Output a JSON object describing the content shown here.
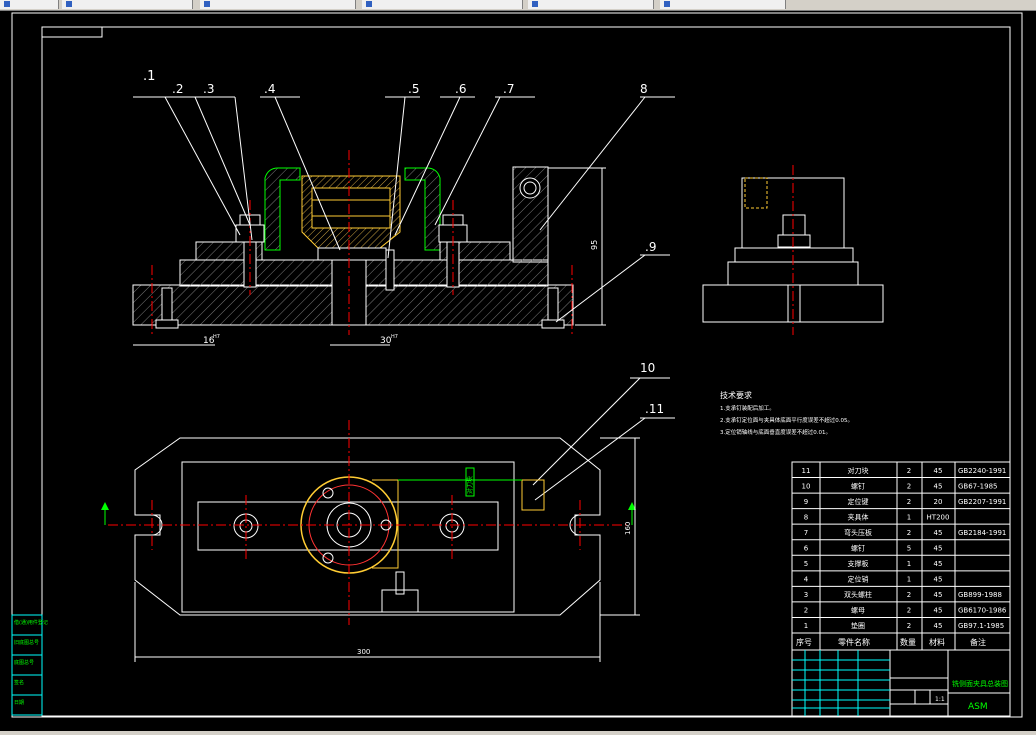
{
  "toolbar": {
    "tabs": [
      {
        "label": ""
      },
      {
        "label": ""
      },
      {
        "label": ""
      },
      {
        "label": ""
      },
      {
        "label": ""
      },
      {
        "label": ""
      }
    ]
  },
  "leader_labels": [
    ".1",
    ".2",
    ".3",
    ".4",
    ".5",
    ".6",
    ".7",
    "8",
    ".9",
    "10",
    ".11"
  ],
  "dims": {
    "d1": "16",
    "d1_tol": "H7",
    "d2": "30",
    "d2_tol": "H7",
    "height": "95",
    "width_plan": "300",
    "depth_plan": "160"
  },
  "tech": {
    "title": "技术要求",
    "items": [
      "1.支承钉装配后加工。",
      "2.支承钉定位面与夹具体底面平行度误差不超过0.05。",
      "3.定位销轴线与底面垂直度误差不超过0.01。"
    ]
  },
  "annotation_green": "对刀块",
  "bom": {
    "headers": {
      "no": "序号",
      "name": "零件名称",
      "qty": "数量",
      "mat": "材料",
      "note": "备注"
    },
    "rows": [
      {
        "no": "11",
        "name": "对刀块",
        "qty": "2",
        "mat": "45",
        "note": "GB2240-1991"
      },
      {
        "no": "10",
        "name": "螺钉",
        "qty": "2",
        "mat": "45",
        "note": "GB67-1985"
      },
      {
        "no": "9",
        "name": "定位键",
        "qty": "2",
        "mat": "20",
        "note": "GB2207-1991"
      },
      {
        "no": "8",
        "name": "夹具体",
        "qty": "1",
        "mat": "HT200",
        "note": ""
      },
      {
        "no": "7",
        "name": "弯头压板",
        "qty": "2",
        "mat": "45",
        "note": "GB2184-1991"
      },
      {
        "no": "6",
        "name": "螺钉",
        "qty": "5",
        "mat": "45",
        "note": ""
      },
      {
        "no": "5",
        "name": "支撑板",
        "qty": "1",
        "mat": "45",
        "note": ""
      },
      {
        "no": "4",
        "name": "定位销",
        "qty": "1",
        "mat": "45",
        "note": ""
      },
      {
        "no": "3",
        "name": "双头螺柱",
        "qty": "2",
        "mat": "45",
        "note": "GB899-1988"
      },
      {
        "no": "2",
        "name": "螺母",
        "qty": "2",
        "mat": "45",
        "note": "GB6170-1986"
      },
      {
        "no": "1",
        "name": "垫圈",
        "qty": "2",
        "mat": "45",
        "note": "GB97.1-1985"
      }
    ]
  },
  "title_block": {
    "drawing_name": "铣侧面夹具总装图",
    "code": "ASM",
    "scale": "1:1"
  },
  "left_strip": [
    "借(通)用件登记",
    "旧底图总号",
    "底图总号",
    "签名",
    "日期"
  ],
  "colors": {
    "outline": "#ffffff",
    "cyan": "#00ffff",
    "green": "#00ff00",
    "red": "#ff0000",
    "yellow": "#ffff00",
    "hatch": "#7a7a7a"
  }
}
